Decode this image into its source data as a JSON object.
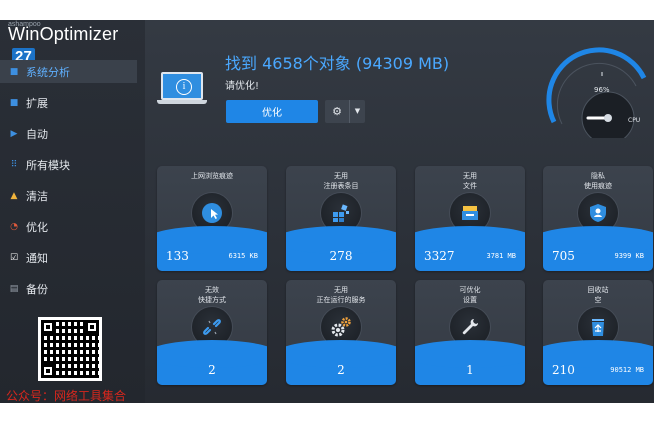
{
  "brand": {
    "small": "ashampoo",
    "name": "WinOptimizer",
    "version": "27"
  },
  "sidebar": {
    "items": [
      {
        "label": "系统分析",
        "icon": "square-icon",
        "glyph": "■",
        "active": true
      },
      {
        "label": "扩展",
        "icon": "square-icon",
        "glyph": "■",
        "active": false
      },
      {
        "label": "自动",
        "icon": "play-icon",
        "glyph": "▶",
        "active": false
      },
      {
        "label": "所有模块",
        "icon": "grid-icon",
        "glyph": "⠿",
        "active": false
      },
      {
        "label": "清洁",
        "icon": "broom-icon",
        "glyph": "▲",
        "active": false
      },
      {
        "label": "优化",
        "icon": "gauge-icon",
        "glyph": "◔",
        "active": false
      },
      {
        "label": "通知",
        "icon": "checkbox-icon",
        "glyph": "☑",
        "active": false
      },
      {
        "label": "备份",
        "icon": "backup-icon",
        "glyph": "▤",
        "active": false
      }
    ]
  },
  "watermark": "公众号：网络工具集合",
  "header": {
    "headline": "找到 4658个对象 (94309 MB)",
    "subhead": "请优化!",
    "optimize_label": "优化",
    "gear_glyph": "⚙",
    "dropdown_glyph": "▼"
  },
  "gauge": {
    "value_label": "96%",
    "cpu_label": "CPU",
    "level": 0.96
  },
  "tiles": [
    {
      "label": "上网浏览痕迹",
      "count": "133",
      "size": "6315 KB",
      "icon": "cursor-icon"
    },
    {
      "label": "无用\n注册表条目",
      "count": "278",
      "size": "",
      "icon": "registry-icon"
    },
    {
      "label": "无用\n文件",
      "count": "3327",
      "size": "3781 MB",
      "icon": "files-icon"
    },
    {
      "label": "隐私\n使用痕迹",
      "count": "705",
      "size": "9399 KB",
      "icon": "shield-icon"
    },
    {
      "label": "无效\n快捷方式",
      "count": "2",
      "size": "",
      "icon": "broken-link-icon"
    },
    {
      "label": "无用\n正在运行的服务",
      "count": "2",
      "size": "",
      "icon": "gears-icon"
    },
    {
      "label": "可优化\n设置",
      "count": "1",
      "size": "",
      "icon": "wrench-icon"
    },
    {
      "label": "回收站\n空",
      "count": "210",
      "size": "90512 MB",
      "icon": "recycle-bin-icon"
    }
  ],
  "colors": {
    "accent": "#1f86e6",
    "headline": "#4aa8ff",
    "background": "#2b3038",
    "watermark": "#d8271d"
  }
}
